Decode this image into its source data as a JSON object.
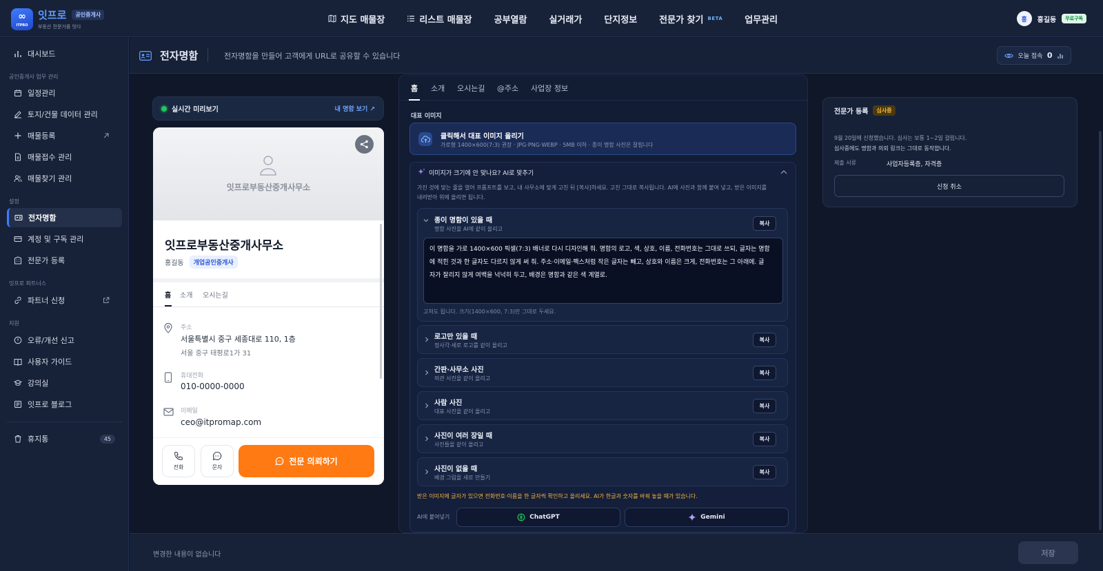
{
  "brand": {
    "name": "잇프로",
    "badge": "공인중개사",
    "tagline": "부동산 전문가를 잇다",
    "logo_text": "ITPRO"
  },
  "nav": [
    {
      "label": "지도 매물장",
      "icon": "map-icon"
    },
    {
      "label": "리스트 매물장",
      "icon": "list-icon"
    },
    {
      "label": "공부열람",
      "icon": ""
    },
    {
      "label": "실거래가",
      "icon": ""
    },
    {
      "label": "단지정보",
      "icon": ""
    },
    {
      "label": "전문가 찾기",
      "icon": "",
      "badge": "BETA"
    },
    {
      "label": "업무관리",
      "icon": ""
    }
  ],
  "user": {
    "avatar": "홍",
    "name": "홍길동",
    "plan": "무료구독"
  },
  "sidebar": {
    "dashboard": "대시보드",
    "section1": "공인중개사 업무 관리",
    "schedule": "일정관리",
    "land": "토지/건물 데이터 관리",
    "listing": "매물등록",
    "reception": "매물접수 관리",
    "finding": "매물찾기 관리",
    "section2": "설정",
    "bizcard": "전자명함",
    "account": "계정 및 구독 관리",
    "expert": "전문가 등록",
    "section3": "잇프로 파트너스",
    "partner": "파트너 신청",
    "section4": "지원",
    "report": "오류/개선 신고",
    "guide": "사용자 가이드",
    "lecture": "강의실",
    "blog": "잇프로 블로그",
    "trash": "휴지통",
    "trash_count": "45"
  },
  "page": {
    "title": "전자명함",
    "desc": "전자명함을 만들어 고객에게 URL로 공유할 수 있습니다",
    "today_label": "오늘 접속",
    "today_count": "0"
  },
  "preview": {
    "live": "실시간 미리보기",
    "mycard": "내 명함 보기 ↗",
    "cover_name": "잇프로부동산중개사무소",
    "office": "잇프로부동산중개사무소",
    "person": "홍길동",
    "role": "개업공인중개사",
    "tabs": [
      "홈",
      "소개",
      "오시는길"
    ],
    "addr_label": "주소",
    "addr1": "서울특별시 중구 세종대로 110, 1층",
    "addr2": "서울 중구 태평로1가 31",
    "phone_label": "휴대전화",
    "phone": "010-0000-0000",
    "email_label": "이메일",
    "email": "ceo@itpromap.com",
    "call": "전화",
    "sms": "문자",
    "cta": "전문 의뢰하기"
  },
  "editor": {
    "tabs": [
      "홈",
      "소개",
      "오시는길",
      "@주소",
      "사업장 정보"
    ],
    "rep_label": "대표 이미지",
    "upload_title": "클릭해서 대표 이미지 올리기",
    "upload_hint": "가로형 1400×600(7:3) 권장 · JPG·PNG·WEBP · 5MB 이하 · 종이 명함 사진은 잘립니다",
    "ai_title": "이미지가 크기에 안 맞나요? AI로 맞추기",
    "ai_desc1": "가진 것에 맞는 줄을 열어 프롬프트를 보고, 내 사무소에 맞게 고친 뒤 [복사]하세요. 고친 그대로 복사됩니다. AI에 사진과 함께 붙여 넣고, 받은 이미지를",
    "ai_desc2": "내려받아 위에 올리면 됩니다.",
    "copy": "복사",
    "paper_title": "종이 명함이 있을 때",
    "paper_sub": "명함 사진을 AI에 같이 올리고",
    "prompt1": "이 명함을 가로 1400×600 픽셀(7:3) 배너로 다시 디자인해 줘. 명함의 로고, 색, 상호, 이름, 전화번호는 그대로 쓰되, 글자는 명함",
    "prompt2": "에 적힌 것과 한 글자도 다르지 않게 써 줘. 주소·이메일·팩스처럼 작은 글자는 빼고, 상호와 이름은 크게, 전화번호는 그 아래에. 글",
    "prompt3": "자가 잘리지 않게 여백을 넉넉히 두고, 배경은 명함과 같은 색 계열로.",
    "edit_hint": "고쳐도 됩니다. 크기(1400×600, 7:3)만 그대로 두세요.",
    "options": [
      {
        "title": "로고만 있을 때",
        "sub": "정사각·세로 로고를 같이 올리고"
      },
      {
        "title": "간판·사무소 사진",
        "sub": "외관 사진을 같이 올리고"
      },
      {
        "title": "사람 사진",
        "sub": "대표 사진을 같이 올리고"
      },
      {
        "title": "사진이 여러 장일 때",
        "sub": "사진들을 같이 올리고"
      },
      {
        "title": "사진이 없을 때",
        "sub": "배경 그림을 새로 만들기"
      }
    ],
    "warning": "받은 이미지에 글자가 있으면 전화번호·이름을 한 글자씩 확인하고 올리세요. AI가 한글과 숫자를 바꿔 놓을 때가 있습니다.",
    "paste_label": "AI에 붙여넣기",
    "chatgpt": "ChatGPT",
    "gemini": "Gemini"
  },
  "expert": {
    "title": "전문가 등록",
    "status": "심사중",
    "line1": "9월 20일에 신청했습니다. 심사는 보통 1~2일 걸립니다.",
    "line2": "심사중에도 명함과 의뢰 링크는 그대로 동작합니다.",
    "docs_label": "제출 서류",
    "docs": "사업자등록증, 자격증",
    "cancel": "신청 취소"
  },
  "footer": {
    "status": "변경한 내용이 없습니다",
    "save": "저장"
  },
  "colors": {
    "accent": "#ff7a12",
    "primary": "#2f6bff",
    "bg": "#0f1729",
    "panel": "#172238"
  }
}
